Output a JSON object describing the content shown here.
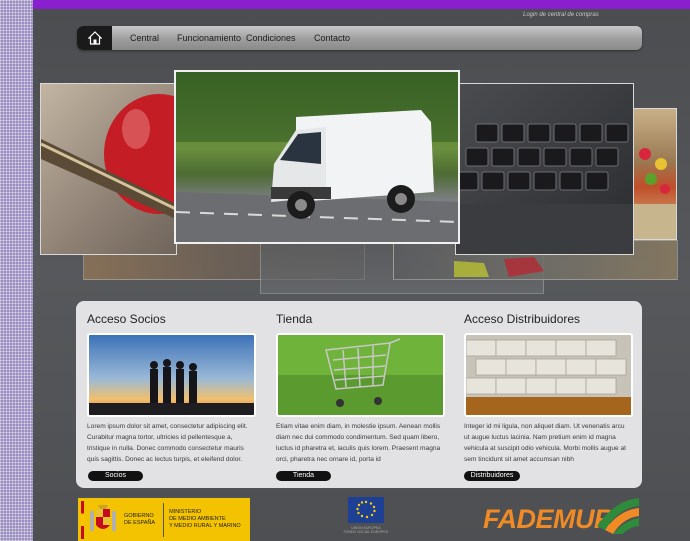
{
  "header": {
    "top_link": "Login de central de compras"
  },
  "nav": {
    "home_icon": "home-icon",
    "items": [
      "Central",
      "Funcionamiento",
      "Condiciones",
      "Contacto"
    ]
  },
  "sections": [
    {
      "title": "Acceso Socios",
      "text": "Lorem ipsum dolor sit amet, consectetur adipiscing elit. Curabitur magna tortor, ultricies id pellentesque a, tristique in nulla. Donec commodo consectetur mauris quis sagittis. Donec ac lectus turpis, et eleifend dolor.",
      "button": "Socios"
    },
    {
      "title": "Tienda",
      "text": "Etiam vitae enim diam, in molestie ipsum. Aenean mollis diam nec dui commodo condimentum. Sed quam libero, luctus id pharetra et, iaculis quis lorem. Praesent magna orci, pharetra nec ornare id, porta id",
      "button": "Tienda"
    },
    {
      "title": "Acceso Distribuidores",
      "text": "Integer id mi ligula, non aliquet diam. Ut venenatis arcu ut augue luctus lacinia. Nam pretium enim id magna vehicula at suscipit odio vehicula. Morbi mollis augue at sem tincidunt sit amet accumsan nibh",
      "button": "Distribuidores"
    }
  ],
  "footer": {
    "gobierno_line1": "GOBIERNO",
    "gobierno_line2": "DE ESPAÑA",
    "ministerio_line1": "MINISTERIO",
    "ministerio_line2": "DE MEDIO AMBIENTE",
    "ministerio_line3": "Y MEDIO RURAL Y MARINO",
    "eu_line1": "UNIÓN EUROPEA",
    "eu_line2": "FONDO SOCIAL EUROPEO",
    "brand": "FADEMUR"
  },
  "colors": {
    "top_bar": "#8a1fd0",
    "accent_orange": "#f08a24",
    "accent_green": "#2e8b3c"
  }
}
